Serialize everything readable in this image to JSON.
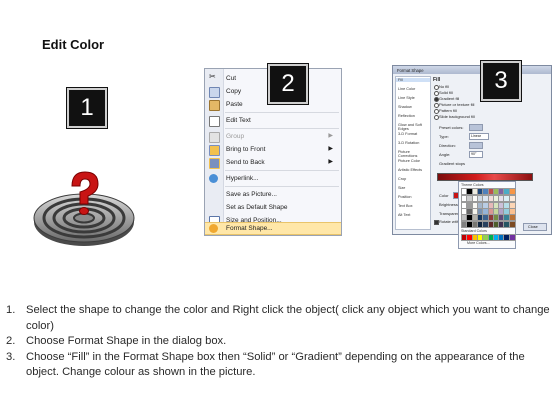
{
  "heading": "Edit Color",
  "badges": {
    "one": "1",
    "two": "2",
    "three": "3"
  },
  "context_menu": {
    "items": [
      {
        "label": "Cut",
        "icon": "scissors-icon",
        "disabled": false,
        "submenu": false
      },
      {
        "label": "Copy",
        "icon": "copy-icon",
        "disabled": false,
        "submenu": false
      },
      {
        "label": "Paste",
        "icon": "paste-icon",
        "disabled": false,
        "submenu": false
      },
      {
        "label": "Edit Text",
        "icon": "edit-text-icon",
        "disabled": false,
        "submenu": false
      },
      {
        "label": "Group",
        "icon": "group-icon",
        "disabled": true,
        "submenu": true
      },
      {
        "label": "Bring to Front",
        "icon": "bring-front-icon",
        "disabled": false,
        "submenu": true
      },
      {
        "label": "Send to Back",
        "icon": "send-back-icon",
        "disabled": false,
        "submenu": true
      },
      {
        "label": "Hyperlink...",
        "icon": "hyperlink-icon",
        "disabled": false,
        "submenu": false
      },
      {
        "label": "Save as Picture...",
        "icon": "",
        "disabled": false,
        "submenu": false
      },
      {
        "label": "Set as Default Shape",
        "icon": "",
        "disabled": false,
        "submenu": false
      },
      {
        "label": "Size and Position...",
        "icon": "size-position-icon",
        "disabled": false,
        "submenu": false
      },
      {
        "label": "Format Shape...",
        "icon": "format-shape-icon",
        "disabled": false,
        "submenu": false,
        "selected": true
      }
    ]
  },
  "format_dialog": {
    "title": "Format Shape",
    "nav": [
      "Fill",
      "Line Color",
      "Line Style",
      "Shadow",
      "Reflection",
      "Glow and Soft Edges",
      "3-D Format",
      "3-D Rotation",
      "Picture Corrections",
      "Picture Color",
      "Artistic Effects",
      "Crop",
      "Size",
      "Position",
      "Text Box",
      "Alt Text"
    ],
    "pane_title": "Fill",
    "fill_options": [
      "No fill",
      "Solid fill",
      "Gradient fill",
      "Picture or texture fill",
      "Pattern fill",
      "Slide background fill"
    ],
    "labels": {
      "preset": "Preset colors:",
      "type": "Type:",
      "direction": "Direction:",
      "angle": "Angle:",
      "angle_value": "90°",
      "stops": "Gradient stops",
      "color": "Color",
      "brightness": "Brightness:",
      "transparency": "Transparency:",
      "rotate": "Rotate with shape",
      "type_value": "Linear",
      "close": "Close"
    },
    "palette": {
      "theme_label": "Theme Colors",
      "standard_label": "Standard Colors",
      "more_label": "More Colors..."
    }
  },
  "colors": {
    "theme": [
      "#ffffff",
      "#000000",
      "#eeece1",
      "#1f497d",
      "#4f81bd",
      "#c0504d",
      "#9bbb59",
      "#8064a2",
      "#4bacc6",
      "#f79646"
    ],
    "standard": [
      "#c00000",
      "#ff0000",
      "#ffc000",
      "#ffff00",
      "#92d050",
      "#00b050",
      "#00b0f0",
      "#0070c0",
      "#002060",
      "#7030a0"
    ]
  },
  "steps": [
    {
      "num": "1.",
      "text": "Select the shape to change the color and Right click the object( click any object which you want to change color)"
    },
    {
      "num": "2.",
      "text": "Choose Format Shape in the dialog box."
    },
    {
      "num": "3.",
      "text": "Choose “Fill” in the Format Shape box then “Solid” or “Gradient” depending on the appearance of the object. Change colour as shown in the picture."
    }
  ]
}
